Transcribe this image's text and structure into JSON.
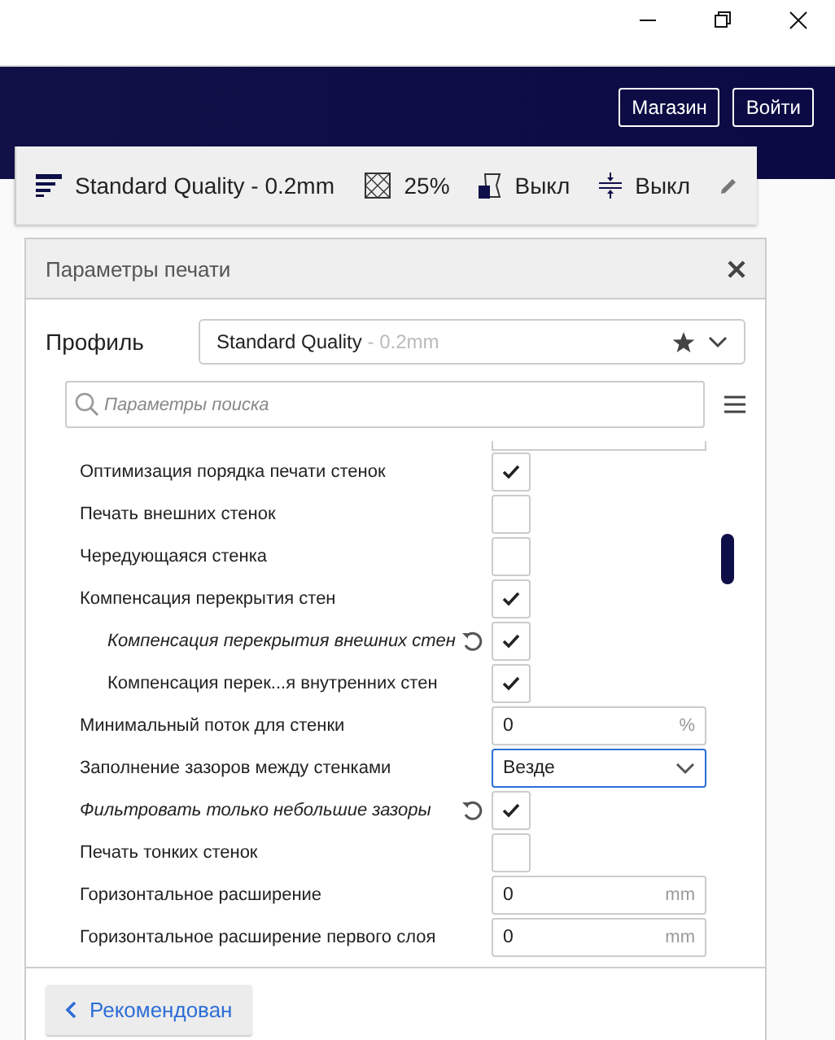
{
  "header": {
    "buttons": [
      "Магазин",
      "Войти"
    ]
  },
  "toolbar": {
    "profile": "Standard Quality - 0.2mm",
    "infill": "25%",
    "support": "Выкл",
    "adhesion": "Выкл"
  },
  "panel": {
    "title": "Параметры печати",
    "profile_label": "Профиль",
    "profile": {
      "name": "Standard Quality",
      "detail": "- 0.2mm"
    },
    "search": {
      "placeholder": "Параметры поиска"
    },
    "settings": [
      {
        "label": "Оптимизация порядка печати стенок",
        "kind": "checkbox",
        "checked": true,
        "modified": false
      },
      {
        "label": "Печать внешних стенок",
        "kind": "checkbox",
        "checked": false,
        "modified": false
      },
      {
        "label": "Чередующаяся стенка",
        "kind": "checkbox",
        "checked": false,
        "modified": false
      },
      {
        "label": "Компенсация перекрытия стен",
        "kind": "checkbox",
        "checked": true,
        "modified": false,
        "children": [
          {
            "label": "Компенсация перекрытия внешних стен",
            "kind": "checkbox",
            "checked": true,
            "modified": true
          },
          {
            "label": "Компенсация перек...я внутренних стен",
            "kind": "checkbox",
            "checked": true,
            "modified": false
          }
        ]
      },
      {
        "label": "Минимальный поток для стенки",
        "kind": "number",
        "value": "0",
        "unit": "%",
        "modified": false
      },
      {
        "label": "Заполнение зазоров между стенками",
        "kind": "select",
        "value": "Везде",
        "focused": true,
        "modified": false
      },
      {
        "label": "Фильтровать только небольшие зазоры",
        "kind": "checkbox",
        "checked": true,
        "modified": true
      },
      {
        "label": "Печать тонких стенок",
        "kind": "checkbox",
        "checked": false,
        "modified": false
      },
      {
        "label": "Горизонтальное расширение",
        "kind": "number",
        "value": "0",
        "unit": "mm",
        "modified": false
      },
      {
        "label": "Горизонтальное расширение первого слоя",
        "kind": "number",
        "value": "0",
        "unit": "mm",
        "modified": false
      }
    ],
    "back_button": "Рекомендован"
  }
}
